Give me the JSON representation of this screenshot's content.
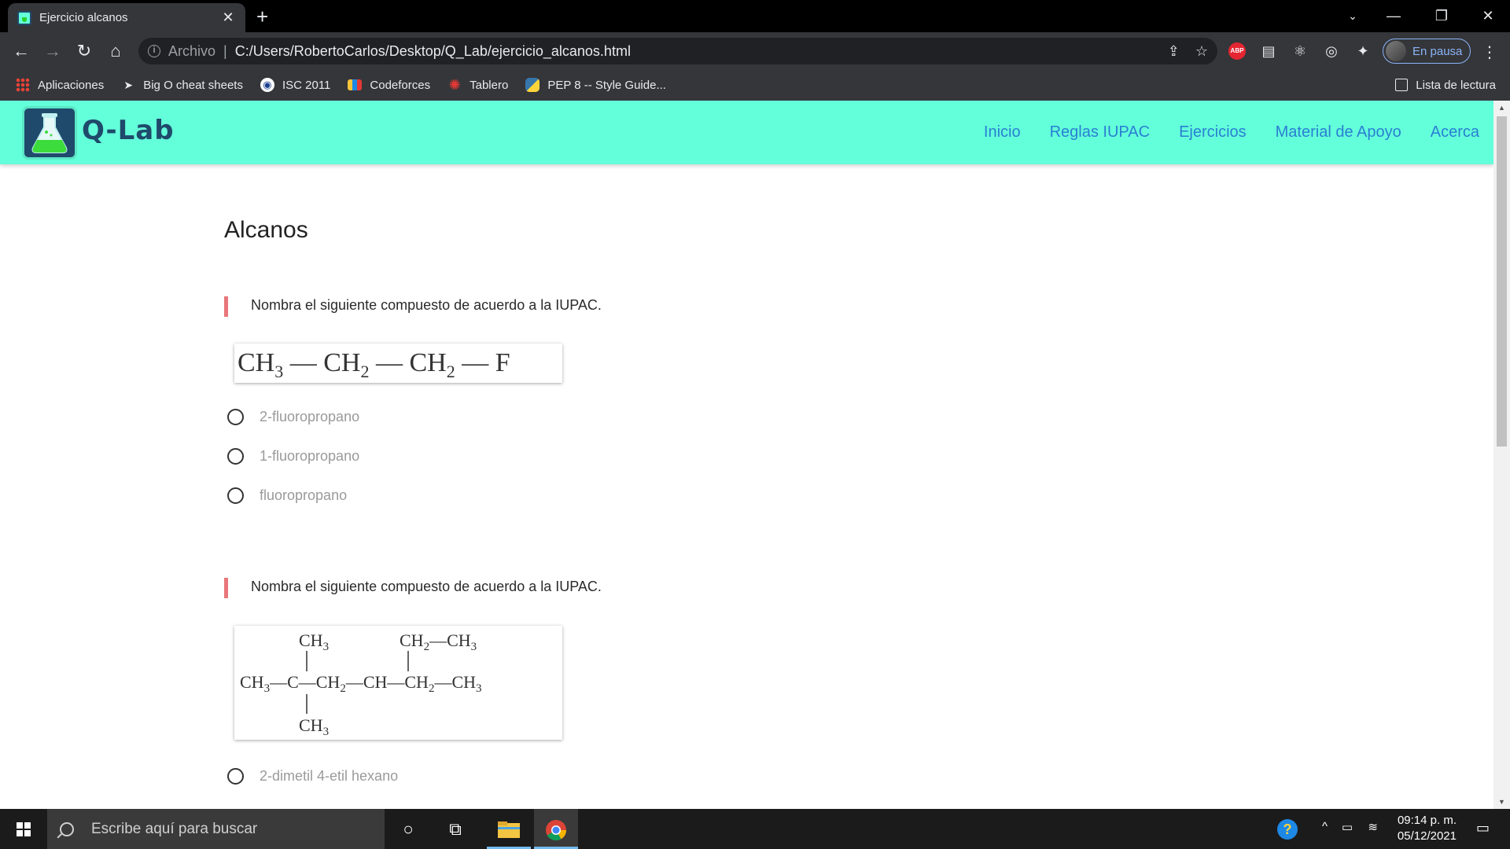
{
  "browser": {
    "tab_title": "Ejercicio alcanos",
    "address_scheme": "Archivo",
    "address_url": "C:/Users/RobertoCarlos/Desktop/Q_Lab/ejercicio_alcanos.html",
    "profile_label": "En pausa",
    "abp_label": "ABP"
  },
  "bookmarks": {
    "items": [
      {
        "label": "Aplicaciones",
        "icon": "apps-grid-icon"
      },
      {
        "label": "Big O cheat sheets",
        "icon": "bookmark-flag-icon"
      },
      {
        "label": "ISC 2011",
        "icon": "globe-icon"
      },
      {
        "label": "Codeforces",
        "icon": "codeforces-icon"
      },
      {
        "label": "Tablero",
        "icon": "gear-badge-icon"
      },
      {
        "label": "PEP 8 -- Style Guide...",
        "icon": "python-icon"
      }
    ],
    "reading_list": "Lista de lectura"
  },
  "site": {
    "logo_text": "Q-Lab",
    "nav": [
      "Inicio",
      "Reglas IUPAC",
      "Ejercicios",
      "Material de Apoyo",
      "Acerca"
    ],
    "accent_color": "#63ffda",
    "link_color": "#2a7ed3"
  },
  "page": {
    "title": "Alcanos",
    "questions": [
      {
        "prompt": "Nombra el siguiente compuesto de acuerdo a la IUPAC.",
        "formula": "CH3 — CH2 — CH2 — F",
        "options": [
          "2-fluoropropano",
          "1-fluoropropano",
          "fluoropropano"
        ]
      },
      {
        "prompt": "Nombra el siguiente compuesto de acuerdo a la IUPAC.",
        "formula": "CH3—C(CH3)2—CH2—CH(CH2—CH3)—CH2—CH3",
        "options": [
          "2-dimetil 4-etil hexano"
        ]
      }
    ]
  },
  "taskbar": {
    "search_placeholder": "Escribe aquí para buscar",
    "time": "09:14 p. m.",
    "date": "05/12/2021"
  }
}
